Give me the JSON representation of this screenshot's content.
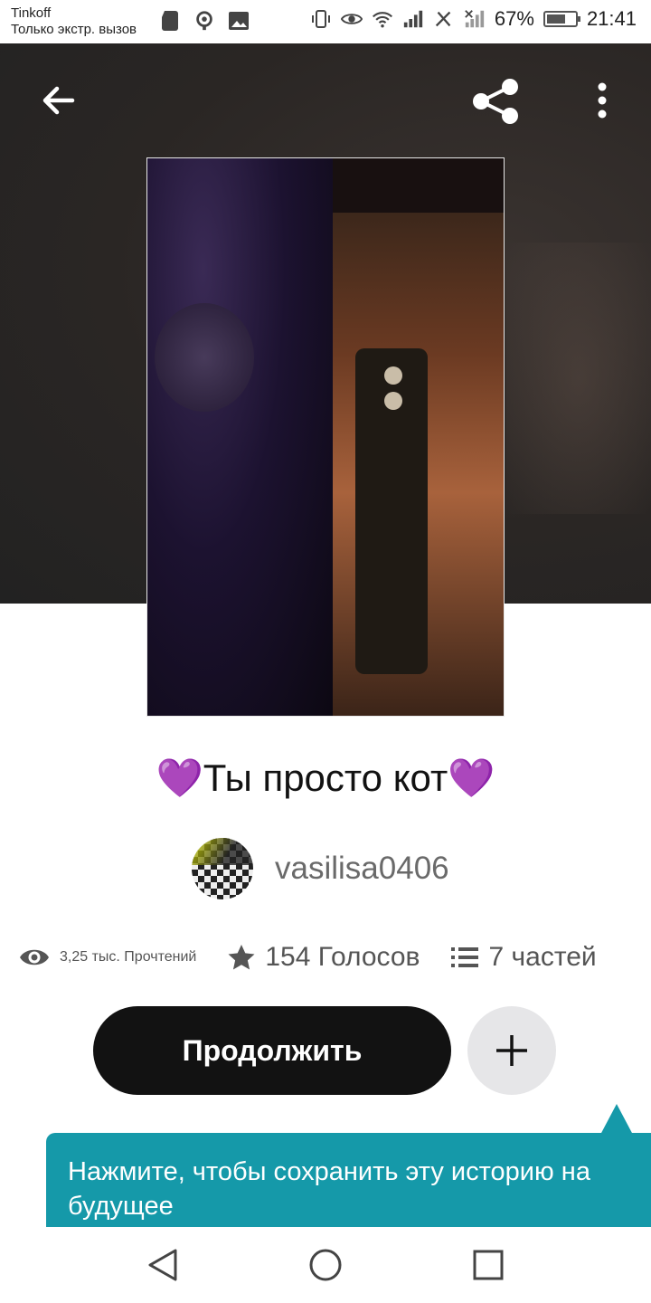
{
  "status_bar": {
    "carrier_line1": "Tinkoff",
    "carrier_line2": "Только экстр. вызов",
    "battery_percent": "67%",
    "battery_level": 0.67,
    "time": "21:41"
  },
  "story": {
    "title_heart_left": "💜",
    "title_text": "Ты просто кот",
    "title_heart_right": "💜",
    "author": "vasilisa0406"
  },
  "stats": {
    "reads": "3,25 тыс. Прочтений",
    "votes": "154 Голосов",
    "parts": "7 частей"
  },
  "actions": {
    "continue_label": "Продолжить"
  },
  "tooltip": {
    "text": "Нажмите, чтобы сохранить эту историю на будущее"
  },
  "colors": {
    "accent": "#1599a9",
    "button_dark": "#121212",
    "heart": "#8a2be2"
  },
  "icons": [
    "back-arrow-icon",
    "share-icon",
    "more-vert-icon",
    "eye-icon",
    "star-icon",
    "list-icon",
    "plus-icon"
  ]
}
